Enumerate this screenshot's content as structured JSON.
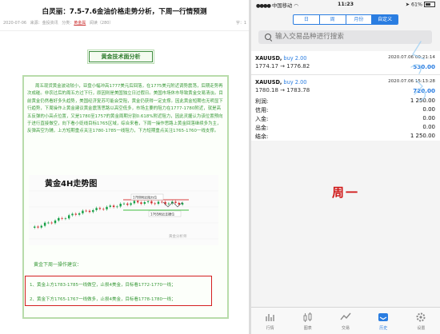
{
  "article": {
    "title": "白灵丽：7.5-7.6金油价格走势分析，下周一行情预测",
    "meta": {
      "date": "2020-07-06",
      "source": "来源：",
      "source_name": "金投资讯",
      "category_label": "分类：",
      "category": "黄金属",
      "reads": "阅读（280）",
      "font_size": "字：1"
    },
    "section_title": "黄金技术面分析",
    "paragraph": "周五现货黄金波动较小，亚盘小幅冲高1777美元后回落，在1775美元附近调势震荡，后期走势再次成碰。非农过后的周五方过下行，原因则是美国独立日过假日。美国市场休市导致黄金交易清淡。目前黄金仍然看好多头趋势，美国经济复苏可能会受阻，黄金仍获得一定支撑。因此黄金短期也无明显下行趋势，下周操作上黄金建议黄金震荡思路以高空低多，市场主要的阻力在1777-1780附近，就是高五反弹的小高点位置，又是1780至1757的黄金周期分割0.618%附近阻力，因此灵握认为该位置预向于进行直接做空，向下看小贬线目标1765区域，综合来看，下周一操作思路上黄金回落继续多为主，反弹高空为辅，上方短期重点关注1780-1785一线阻力，下方短期重点关注1765-1760一线支撑。",
    "chart": {
      "title": "黄金4H走势图",
      "label_upper": "1780附近阻力位",
      "label_lower": "1765附近支撑位",
      "watermark": "黄金分析师"
    },
    "advice_title": "黄金下周一操作建议：",
    "advice": [
      "1、黄金上方1783-1785一线做空，止损4美金，目标看1772-1770一线；",
      "2、黄金下方1765-1767一线做多，止损4美金，目标看1778-1780一线；"
    ]
  },
  "status": {
    "carrier": "中国移动",
    "time": "11:23",
    "battery": "61%"
  },
  "segments": [
    {
      "label": "日",
      "active": false
    },
    {
      "label": "周",
      "active": false
    },
    {
      "label": "月份",
      "active": false
    },
    {
      "label": "自定义",
      "active": true
    }
  ],
  "search": {
    "placeholder": "输入交易品种进行搜索"
  },
  "orders": [
    {
      "symbol": "XAUUSD,",
      "side": "buy 2.00",
      "time": "2020.07.06 00:21:14",
      "price": "1774.17 → 1776.82",
      "profit": "530.00"
    },
    {
      "symbol": "XAUUSD,",
      "side": "buy 2.00",
      "time": "2020.07.06 15:13:28",
      "price": "1780.18 → 1783.78",
      "profit": "720.00"
    }
  ],
  "summary": [
    {
      "label": "利润:",
      "value": "1 250.00"
    },
    {
      "label": "信用:",
      "value": "0.00"
    },
    {
      "label": "入金:",
      "value": "0.00"
    },
    {
      "label": "出金:",
      "value": "0.00"
    },
    {
      "label": "结余:",
      "value": "1 250.00"
    }
  ],
  "overlay_text": "周一",
  "tabs": [
    {
      "label": "行情",
      "icon": "quotes-icon",
      "active": false
    },
    {
      "label": "图表",
      "icon": "chart-icon",
      "active": false
    },
    {
      "label": "交易",
      "icon": "trade-icon",
      "active": false
    },
    {
      "label": "历史",
      "icon": "history-icon",
      "active": true
    },
    {
      "label": "设置",
      "icon": "settings-icon",
      "active": false
    }
  ],
  "colors": {
    "accent": "#2a7de1",
    "article_green": "#3a9a3a",
    "highlight_red": "#d42020"
  }
}
